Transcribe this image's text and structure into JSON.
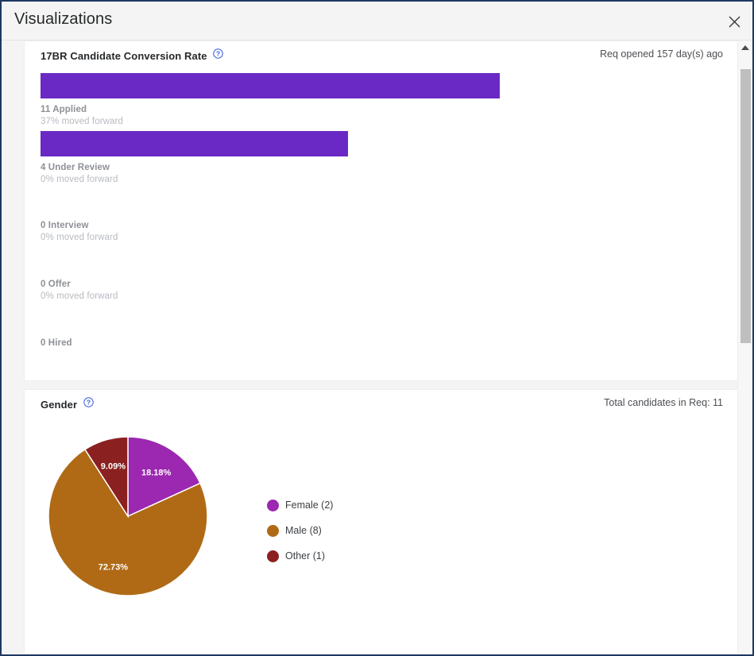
{
  "dialog": {
    "title": "Visualizations",
    "close_label": "close-icon"
  },
  "funnel_card": {
    "title": "17BR Candidate Conversion Rate",
    "help_icon": "help-circle-icon",
    "meta": "Req opened 157  day(s) ago"
  },
  "gender_card": {
    "title": "Gender",
    "help_icon": "help-circle-icon",
    "meta": "Total candidates in Req: 11"
  },
  "chart_data": [
    {
      "type": "bar",
      "title": "17BR Candidate Conversion Rate",
      "orientation": "horizontal",
      "bar_color": "#6a29c4",
      "categories": [
        "Applied",
        "Under Review",
        "Interview",
        "Offer",
        "Hired"
      ],
      "values": [
        11,
        4,
        0,
        0,
        0
      ],
      "labels": [
        "11 Applied",
        "4 Under Review",
        "0 Interview",
        "0 Offer",
        "0 Hired"
      ],
      "sublabels": [
        "37% moved forward",
        "0% moved forward",
        "0% moved forward",
        "0% moved forward",
        ""
      ],
      "conversion_pct": [
        37,
        0,
        0,
        0,
        null
      ],
      "xlabel": "",
      "ylabel": "",
      "grid": false,
      "legend": "none"
    },
    {
      "type": "pie",
      "title": "Gender",
      "total": 11,
      "legend_position": "right",
      "slices": [
        {
          "name": "Female",
          "count": 2,
          "percent": "18.18%",
          "value": 18.18,
          "color": "#9c27b0",
          "legend": "Female (2)"
        },
        {
          "name": "Male",
          "count": 8,
          "percent": "72.73%",
          "value": 72.73,
          "color": "#b06a16",
          "legend": "Male (8)"
        },
        {
          "name": "Other",
          "count": 1,
          "percent": "9.09%",
          "value": 9.09,
          "color": "#8b2020",
          "legend": "Other (1)"
        }
      ]
    }
  ],
  "scrollbar": {
    "up_arrow": "triangle-up-icon"
  }
}
